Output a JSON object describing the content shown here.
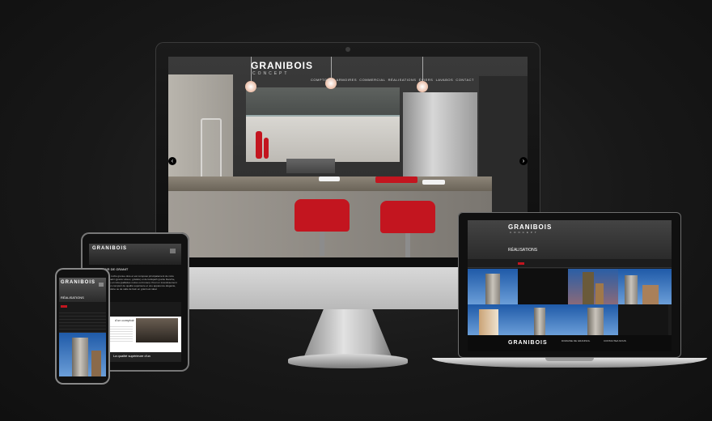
{
  "brand": {
    "logo": "GRANIBOIS",
    "tagline": "CONCEPT"
  },
  "desktop": {
    "nav_items": [
      "COMPTOIRS",
      "ARMOIRES",
      "COMMERCIAL",
      "RÉALISATIONS",
      "ÉVIERS",
      "LAVABOS",
      "CONTACT"
    ]
  },
  "laptop": {
    "section_title": "RÉALISATIONS",
    "footer_logo": "GRANIBOIS",
    "footer_col1": "DOMAINE DE GRANISOL",
    "footer_col2": "CONTACTEZ-NOUS"
  },
  "tablet": {
    "section_title": "COMPTOIR DE GRANIT",
    "body_text": "Le granit est une roche grenue dure et est composé principalement de mica métallique, de quartz (granis vitreux, grisâtre) et de feldspath (partie blanche, rose ou grisonné) et mica (paillettes noires ou brunes). Pour un investissement durable, choisir un comptoir de qualité supérieure et une apparence élégante, le comptoir de cuisine ou de salle de bain en granit est idéal.",
    "card_title": "d'un comptoir",
    "caption": "La qualité supérieure d'un"
  },
  "phone": {
    "section_title": "RÉALISATIONS"
  },
  "colors": {
    "accent": "#c3151f",
    "background": "#141414"
  }
}
